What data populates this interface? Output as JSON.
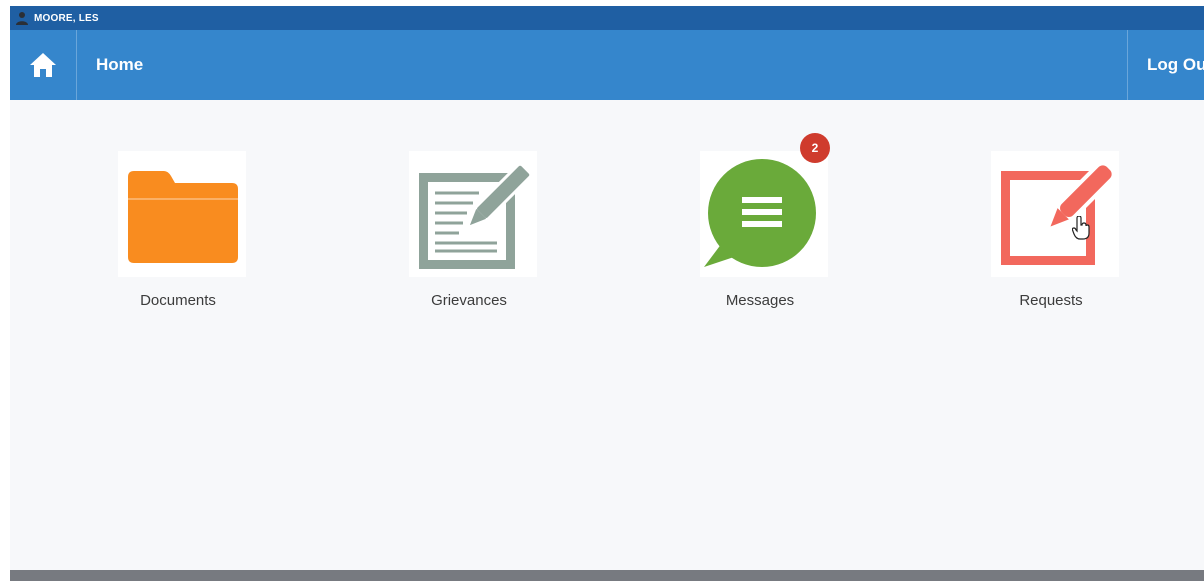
{
  "user": {
    "name": "MOORE, LES"
  },
  "navbar": {
    "home_icon": "home-icon",
    "title": "Home",
    "logout_label": "Log Out"
  },
  "tiles": [
    {
      "label": "Documents",
      "icon": "folder-icon",
      "color": "#f98c1f"
    },
    {
      "label": "Grievances",
      "icon": "edit-document-icon",
      "color": "#8fa39a"
    },
    {
      "label": "Messages",
      "icon": "chat-bubble-icon",
      "color": "#6aaa3a",
      "badge": "2"
    },
    {
      "label": "Requests",
      "icon": "edit-square-icon",
      "color": "#f2685d"
    }
  ],
  "colors": {
    "userbar": "#1f5fa3",
    "navbar": "#3586cc",
    "badge": "#cf3b2d",
    "background": "#f7f8fa"
  }
}
